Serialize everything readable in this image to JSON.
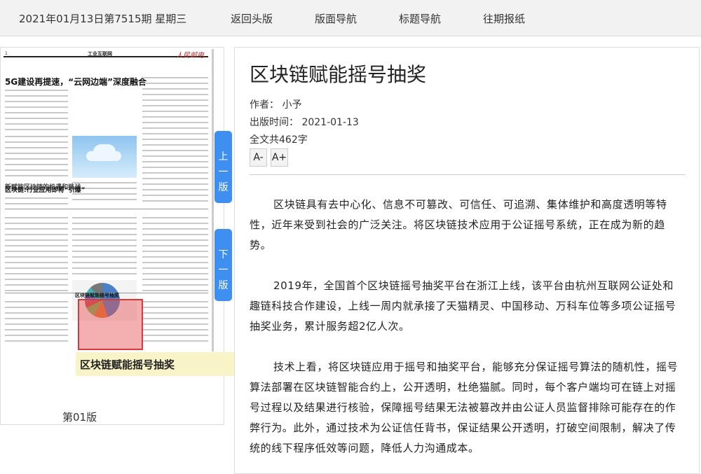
{
  "topbar": {
    "date": "2021年01月13日第7515期 星期三",
    "nav": [
      "返回头版",
      "版面导航",
      "标题导航",
      "往期报纸"
    ]
  },
  "newspaper": {
    "page_no": "1",
    "masthead": "工业互联网",
    "logo": "人民邮电",
    "headline_1": "5G建设再提速，“云网边端”深度融合",
    "headline_2": "区块链:行业应用即将“引爆”",
    "small_heads": [
      "新赋能区块链的机遇和挑战",
      "区块链赋能摇号抽奖"
    ],
    "page_caption": "第01版"
  },
  "tooltip": "区块链赋能摇号抽奖",
  "side_tabs": {
    "prev": [
      "上",
      "一",
      "版"
    ],
    "next": [
      "下",
      "一",
      "版"
    ]
  },
  "article": {
    "title": "区块链赋能摇号抽奖",
    "author": "作者：  小予",
    "publish": "出版时间：  2021-01-13",
    "count": "全文共462字",
    "font_minus": "A-",
    "font_plus": "A+",
    "paragraphs": [
      "区块链具有去中心化、信息不可篡改、可信任、可追溯、集体维护和高度透明等特性，近年来受到社会的广泛关注。将区块链技术应用于公证摇号系统，正在成为新的趋势。",
      "2019年，全国首个区块链摇号抽奖平台在浙江上线，该平台由杭州互联网公证处和趣链科技合作建设，上线一周内就承接了天猫精灵、中国移动、万科车位等多项公证摇号抽奖业务，累计服务超2亿人次。",
      "技术上看，将区块链应用于摇号和抽奖平台，能够充分保证摇号算法的随机性，摇号算法部署在区块链智能合约上，公开透明，杜绝猫腻。同时，每个客户端均可在链上对摇号过程以及结果进行核验，保障摇号结果无法被篡改并由公证人员监督排除可能存在的作弊行为。此外，通过技术为公证信任背书，保证结果公开透明，打破空间限制，解决了传统的线下程序低效等问题，降低人力沟通成本。"
    ]
  }
}
